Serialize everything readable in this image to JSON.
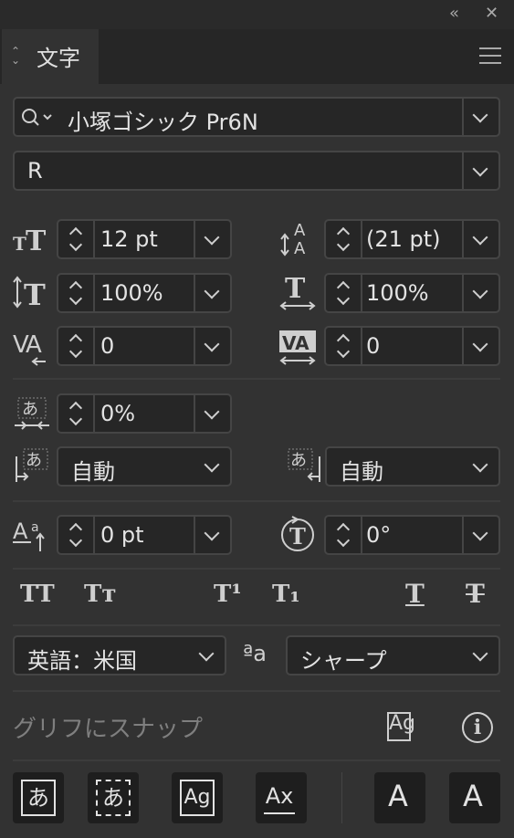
{
  "window": {
    "collapse": "«",
    "close": "✕"
  },
  "panel": {
    "tab_title": "文字"
  },
  "font": {
    "family": "小塚ゴシック Pr6N",
    "style": "R"
  },
  "char": {
    "font_size": "12 pt",
    "leading": "(21 pt)",
    "vscale": "100%",
    "hscale": "100%",
    "kerning": "0",
    "tracking": "0",
    "tsume": "0%",
    "aki_left": "自動",
    "aki_right": "自動",
    "baseline": "0 pt",
    "rotation": "0°"
  },
  "language": {
    "value": "英語：米国",
    "aa_icon": "ªa",
    "antialias": "シャープ"
  },
  "snap": {
    "label": "グリフにスナップ"
  },
  "bottom_buttons": {
    "b1": "あ",
    "b2": "あ",
    "b3": "Ag",
    "b4": "Ax",
    "b5": "A",
    "b6": "A"
  },
  "glyphs": {
    "allcaps": "TT",
    "smallcaps": "Tт",
    "super": "T¹",
    "sub": "T₁",
    "underline": "T",
    "strike": "T",
    "ag": "Ag",
    "info": "i"
  }
}
